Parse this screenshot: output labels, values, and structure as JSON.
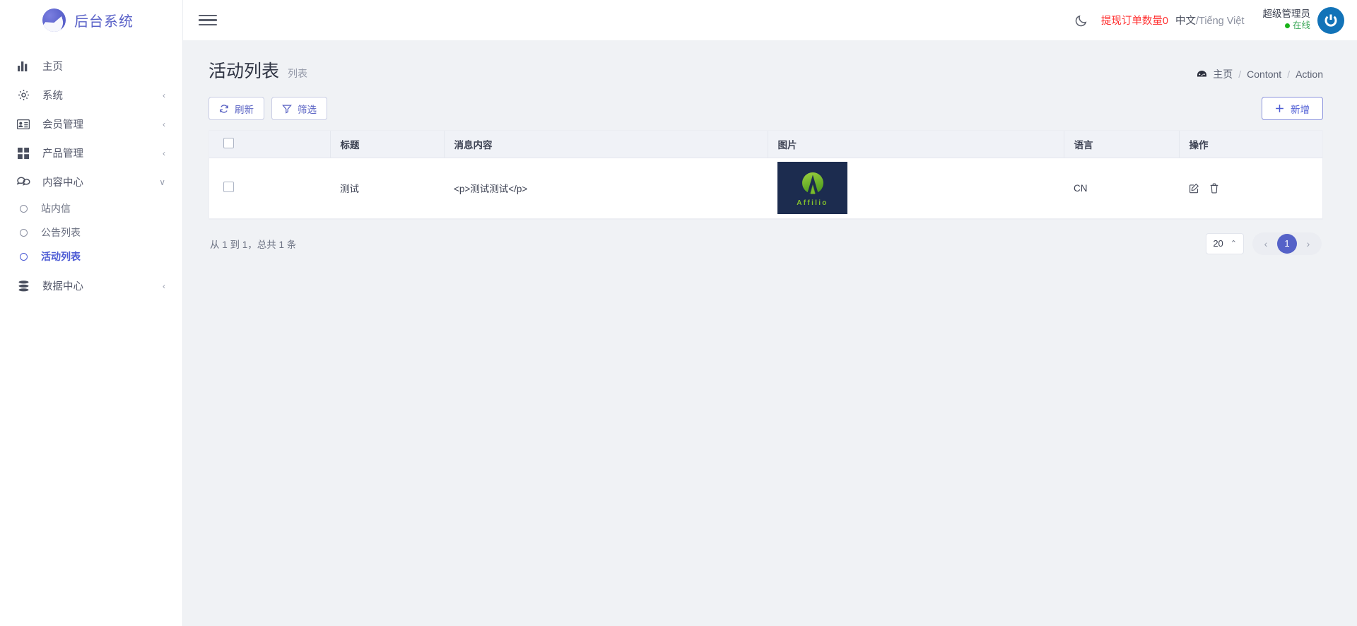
{
  "brand": {
    "logo_icon": "swoosh-circle-logo",
    "name": "后台系统"
  },
  "sidebar": {
    "items": [
      {
        "label": "主页",
        "icon": "bar-chart-icon",
        "chevron": "",
        "expandable": false
      },
      {
        "label": "系统",
        "icon": "gear-icon",
        "chevron": "‹",
        "expandable": true
      },
      {
        "label": "会员管理",
        "icon": "id-card-icon",
        "chevron": "‹",
        "expandable": true
      },
      {
        "label": "产品管理",
        "icon": "grid-icon",
        "chevron": "‹",
        "expandable": true
      },
      {
        "label": "内容中心",
        "icon": "chat-bubbles-icon",
        "chevron": "∨",
        "expandable": true
      }
    ],
    "sub_items": [
      {
        "label": "站内信",
        "active": false
      },
      {
        "label": "公告列表",
        "active": false
      },
      {
        "label": "活动列表",
        "active": true
      }
    ],
    "last_item": {
      "label": "数据中心",
      "icon": "database-icon",
      "chevron": "‹"
    }
  },
  "topbar": {
    "menu_icon": "hamburger-icon",
    "theme_icon": "moon-icon",
    "withdraw_label": "提现订单数量0",
    "language": "中文",
    "language_separator": "/",
    "language_alt": "Tiếng Việt",
    "user_name": "超级管理员",
    "user_status": "在线",
    "avatar_icon": "power-avatar-icon"
  },
  "page": {
    "title": "活动列表",
    "subtitle": "列表",
    "breadcrumb": {
      "home_icon": "dashboard-icon",
      "items": [
        "主页",
        "Contont",
        "Action"
      ],
      "separator": "/"
    }
  },
  "toolbar": {
    "refresh_label": "刷新",
    "refresh_icon": "refresh-icon",
    "filter_label": "筛选",
    "filter_icon": "funnel-icon",
    "add_label": "新增",
    "add_icon": "plus-icon"
  },
  "table": {
    "columns": [
      "",
      "标题",
      "消息内容",
      "图片",
      "语言",
      "操作"
    ],
    "rows": [
      {
        "checked": false,
        "title": "测试",
        "message": "<p>测试测试</p>",
        "image": {
          "alt_text": "Affilio",
          "brand_text": "Affilio",
          "bg": "#1c2c4f",
          "accent": "#84c12c"
        },
        "language": "CN",
        "actions": [
          "edit-icon",
          "delete-icon"
        ]
      }
    ]
  },
  "pagination": {
    "info": "从 1 到 1，总共 1 条",
    "page_size": "20",
    "page_size_caret": "⌃",
    "prev": "‹",
    "next": "›",
    "current_page": "1"
  },
  "colors": {
    "accent": "#4c5bd4",
    "brand": "#5a62c8",
    "danger": "#ff2d2d",
    "online": "#19b319",
    "avatar": "#1273b8"
  }
}
